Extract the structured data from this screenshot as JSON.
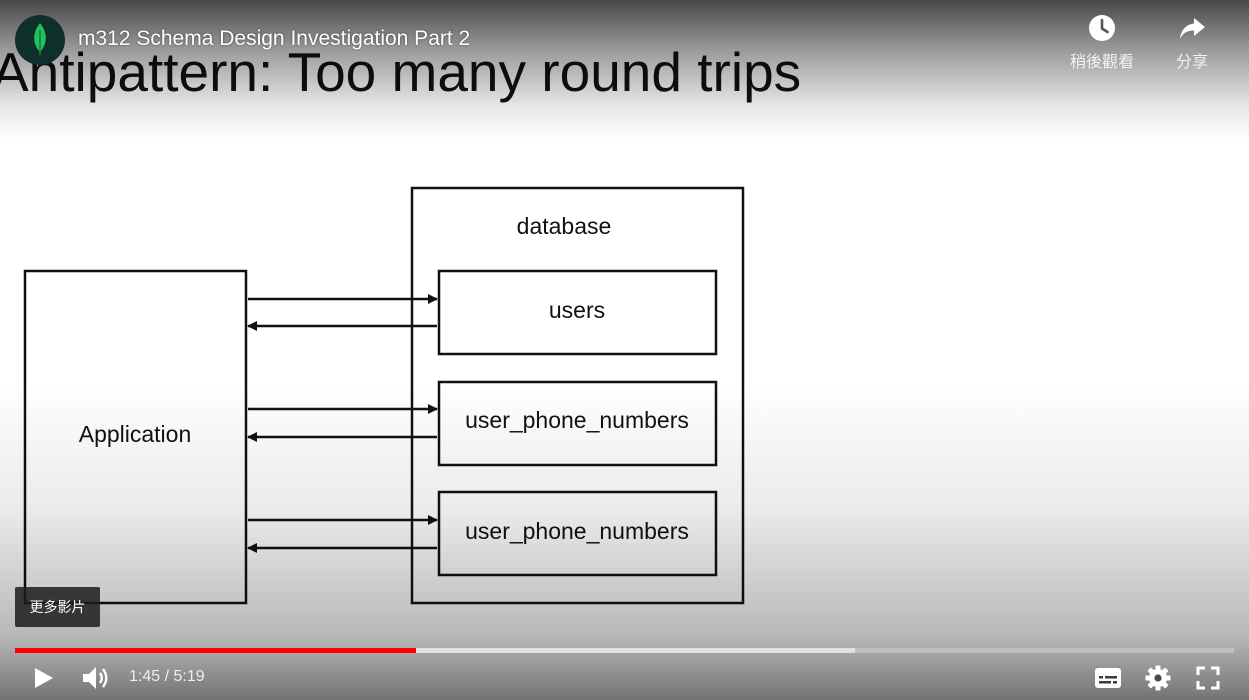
{
  "video": {
    "title": "m312 Schema Design Investigation Part 2",
    "current_time": "1:45",
    "separator": " / ",
    "duration": "5:19",
    "played_fraction": 0.329,
    "buffered_fraction": 0.689
  },
  "top_actions": {
    "watch_later_label": "稍後觀看",
    "share_label": "分享"
  },
  "more_videos_label": "更多影片",
  "slide": {
    "title": "Antipattern: Too many round trips",
    "diagram": {
      "application_label": "Application",
      "database_label": "database",
      "tables": [
        "users",
        "user_phone_numbers",
        "user_phone_numbers"
      ]
    }
  },
  "icons": {
    "channel_avatar": "mongodb-leaf-icon",
    "watch_later": "clock-icon",
    "share": "share-arrow-icon",
    "play": "play-icon",
    "volume": "volume-icon",
    "subtitles": "subtitles-icon",
    "settings": "gear-icon",
    "fullscreen": "fullscreen-icon"
  },
  "colors": {
    "progress_played": "#ff0000",
    "avatar_bg": "#0f2f2a",
    "leaf_green": "#21c25e"
  }
}
